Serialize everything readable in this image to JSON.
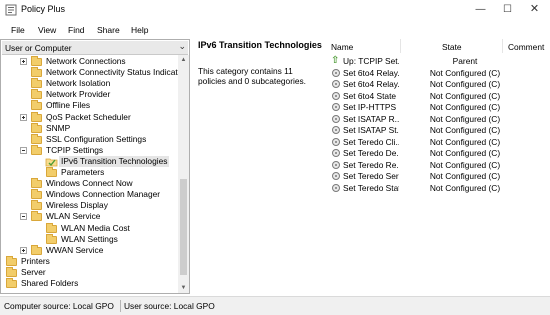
{
  "window": {
    "title": "Policy Plus",
    "min_glyph": "—",
    "max_glyph": "☐",
    "close_glyph": "✕"
  },
  "menu": [
    "File",
    "View",
    "Find",
    "Share",
    "Help"
  ],
  "left": {
    "section_selector": "User or Computer",
    "tree": [
      {
        "label": "Network Connections",
        "expander": "plus",
        "level": 1
      },
      {
        "label": "Network Connectivity Status Indicator",
        "expander": "none",
        "level": 1
      },
      {
        "label": "Network Isolation",
        "expander": "none",
        "level": 1
      },
      {
        "label": "Network Provider",
        "expander": "none",
        "level": 1
      },
      {
        "label": "Offline Files",
        "expander": "none",
        "level": 1
      },
      {
        "label": "QoS Packet Scheduler",
        "expander": "plus",
        "level": 1
      },
      {
        "label": "SNMP",
        "expander": "none",
        "level": 1
      },
      {
        "label": "SSL Configuration Settings",
        "expander": "none",
        "level": 1
      },
      {
        "label": "TCPIP Settings",
        "expander": "minus",
        "level": 1
      },
      {
        "label": "IPv6 Transition Technologies",
        "expander": "none",
        "level": 2,
        "selected": true
      },
      {
        "label": "Parameters",
        "expander": "none",
        "level": 2
      },
      {
        "label": "Windows Connect Now",
        "expander": "none",
        "level": 1
      },
      {
        "label": "Windows Connection Manager",
        "expander": "none",
        "level": 1
      },
      {
        "label": "Wireless Display",
        "expander": "none",
        "level": 1
      },
      {
        "label": "WLAN Service",
        "expander": "minus",
        "level": 1
      },
      {
        "label": "WLAN Media Cost",
        "expander": "none",
        "level": 2
      },
      {
        "label": "WLAN Settings",
        "expander": "none",
        "level": 2
      },
      {
        "label": "WWAN Service",
        "expander": "plus",
        "level": 1
      },
      {
        "label": "Printers",
        "expander": "none",
        "level": 0
      },
      {
        "label": "Server",
        "expander": "none",
        "level": 0
      },
      {
        "label": "Shared Folders",
        "expander": "none",
        "level": 0
      }
    ]
  },
  "detail": {
    "title": "IPv6 Transition Technologies",
    "description": "This category contains 11 policies and 0 subcategories."
  },
  "list": {
    "columns": {
      "name": "Name",
      "state": "State",
      "comment": "Comment"
    },
    "rows": [
      {
        "name": "Up: TCPIP Set...",
        "state": "Parent",
        "icon": "up-arrow-icon"
      },
      {
        "name": "Set 6to4 Relay...",
        "state": "Not Configured (C)",
        "icon": "policy-icon"
      },
      {
        "name": "Set 6to4 Relay...",
        "state": "Not Configured (C)",
        "icon": "policy-icon"
      },
      {
        "name": "Set 6to4 State",
        "state": "Not Configured (C)",
        "icon": "policy-icon"
      },
      {
        "name": "Set IP-HTTPS ...",
        "state": "Not Configured (C)",
        "icon": "policy-icon"
      },
      {
        "name": "Set ISATAP R...",
        "state": "Not Configured (C)",
        "icon": "policy-icon"
      },
      {
        "name": "Set ISATAP St...",
        "state": "Not Configured (C)",
        "icon": "policy-icon"
      },
      {
        "name": "Set Teredo Cli...",
        "state": "Not Configured (C)",
        "icon": "policy-icon"
      },
      {
        "name": "Set Teredo De...",
        "state": "Not Configured (C)",
        "icon": "policy-icon"
      },
      {
        "name": "Set Teredo Re...",
        "state": "Not Configured (C)",
        "icon": "policy-icon"
      },
      {
        "name": "Set Teredo Ser...",
        "state": "Not Configured (C)",
        "icon": "policy-icon"
      },
      {
        "name": "Set Teredo State",
        "state": "Not Configured (C)",
        "icon": "policy-icon"
      }
    ]
  },
  "status": {
    "computer_source": "Computer source:  Local GPO",
    "user_source": "User source:  Local GPO"
  }
}
